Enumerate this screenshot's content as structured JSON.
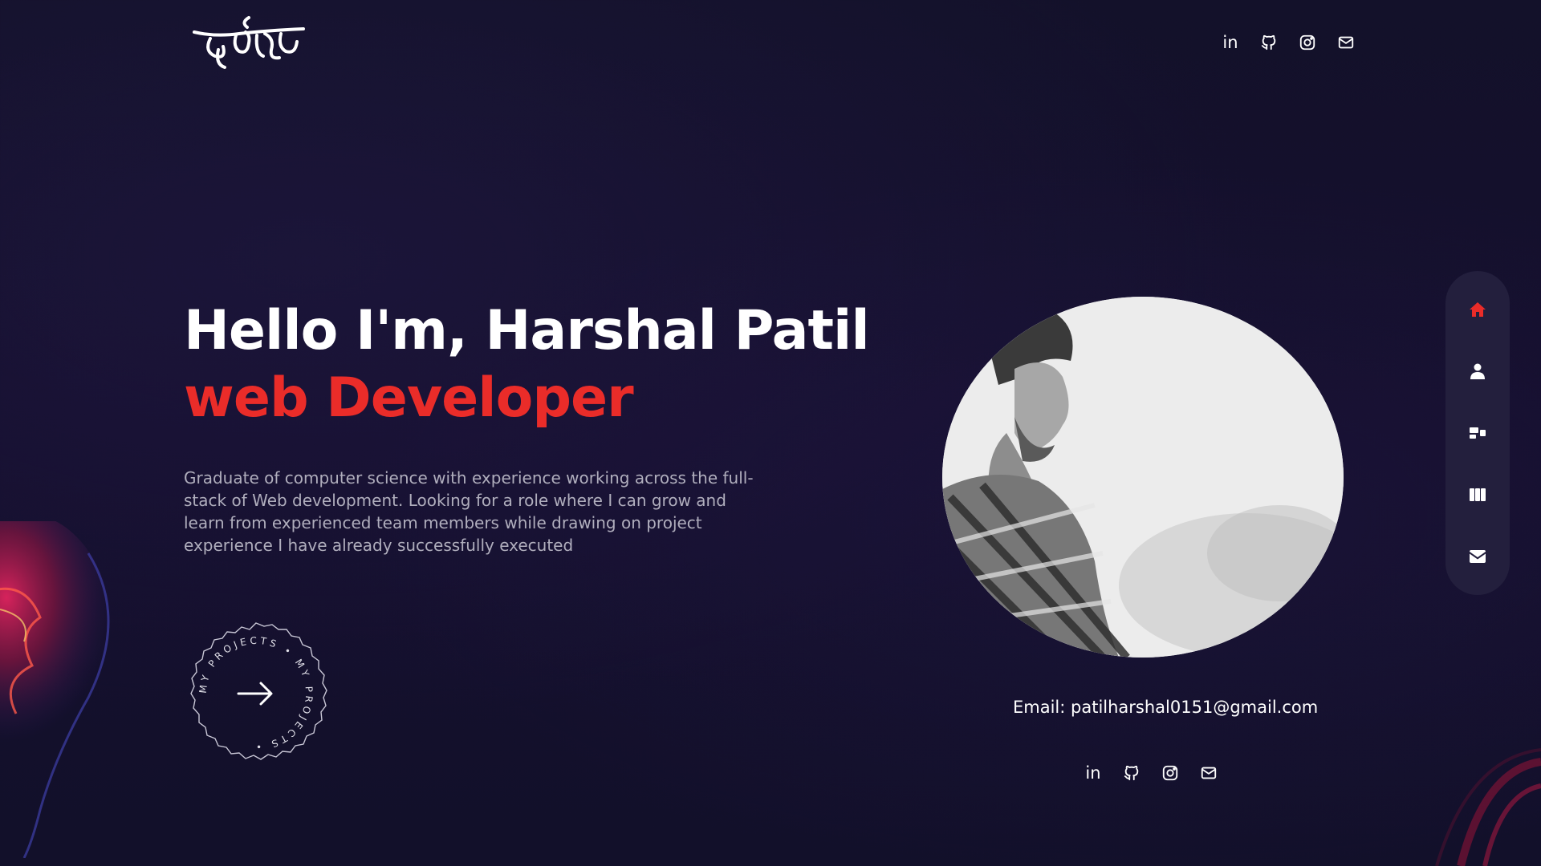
{
  "header": {
    "logo_text": "हर्षल",
    "social": [
      {
        "name": "linkedin",
        "label": "in"
      },
      {
        "name": "github",
        "label": ""
      },
      {
        "name": "instagram",
        "label": ""
      },
      {
        "name": "mail",
        "label": ""
      }
    ]
  },
  "hero": {
    "title": "Hello I'm, Harshal Patil",
    "role": "web Developer",
    "description": "Graduate of computer science with experience working across the full-stack of Web development. Looking for a role where I can grow and learn from experienced team members while drawing on project experience I have already successfully executed",
    "badge_text": "MY PROJECTS • MY PROJECTS •"
  },
  "profile": {
    "email_line": "Email: patilharshal0151@gmail.com"
  },
  "side_nav": {
    "items": [
      {
        "name": "home",
        "active": true
      },
      {
        "name": "about",
        "active": false
      },
      {
        "name": "projects",
        "active": false
      },
      {
        "name": "services",
        "active": false
      },
      {
        "name": "contact",
        "active": false
      }
    ]
  },
  "colors": {
    "accent": "#ea2c29",
    "background": "#13112a",
    "nav_bg": "#231f3d",
    "text_muted": "#b0aebd"
  }
}
